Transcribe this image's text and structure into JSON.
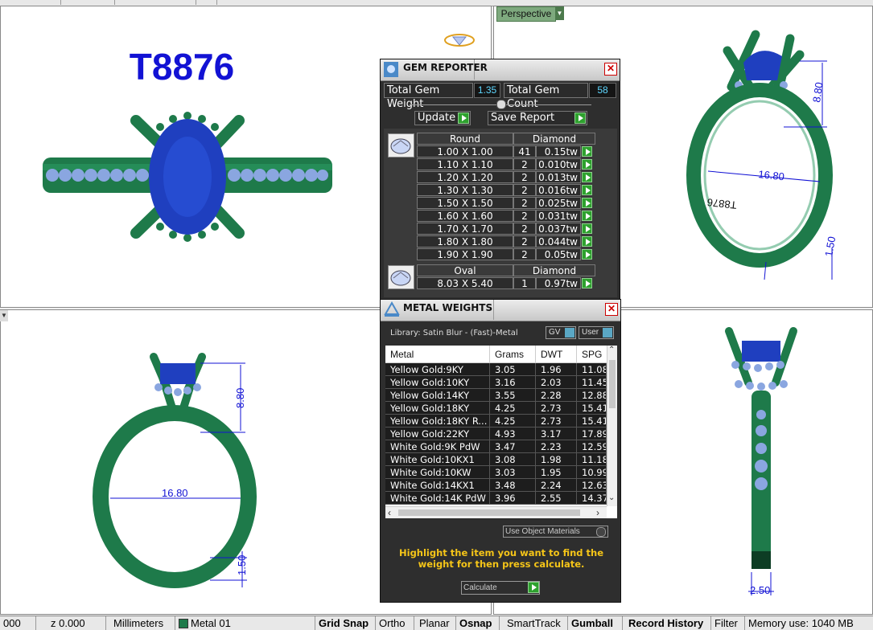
{
  "viewports": {
    "top_left": {
      "title_text": "T8876"
    },
    "top_right": {
      "view_label": "Perspective",
      "dims": {
        "height": "8.80",
        "width": "16.80",
        "band": "1.50",
        "engraving": "T8876"
      }
    },
    "bottom_left": {
      "dims": {
        "height": "8.80",
        "width": "16.80",
        "band": "1.50"
      }
    },
    "bottom_right": {
      "dims": {
        "band_width": "2.50"
      }
    }
  },
  "gem_reporter": {
    "title": "GEM REPORTER",
    "total_weight_label": "Total Gem Weight",
    "total_weight_value": "1.35",
    "total_count_label": "Total Gem Count",
    "total_count_value": "58",
    "update_label": "Update",
    "save_label": "Save Report",
    "groups": [
      {
        "shape": "Round",
        "material": "Diamond",
        "rows": [
          {
            "size": "1.00 X 1.00",
            "count": "41",
            "weight": "0.15tw"
          },
          {
            "size": "1.10 X 1.10",
            "count": "2",
            "weight": "0.010tw"
          },
          {
            "size": "1.20 X 1.20",
            "count": "2",
            "weight": "0.013tw"
          },
          {
            "size": "1.30 X 1.30",
            "count": "2",
            "weight": "0.016tw"
          },
          {
            "size": "1.50 X 1.50",
            "count": "2",
            "weight": "0.025tw"
          },
          {
            "size": "1.60 X 1.60",
            "count": "2",
            "weight": "0.031tw"
          },
          {
            "size": "1.70 X 1.70",
            "count": "2",
            "weight": "0.037tw"
          },
          {
            "size": "1.80 X 1.80",
            "count": "2",
            "weight": "0.044tw"
          },
          {
            "size": "1.90 X 1.90",
            "count": "2",
            "weight": "0.05tw"
          }
        ]
      },
      {
        "shape": "Oval",
        "material": "Diamond",
        "rows": [
          {
            "size": "8.03 X 5.40",
            "count": "1",
            "weight": "0.97tw"
          }
        ]
      }
    ]
  },
  "metal_weights": {
    "title": "METAL WEIGHTS",
    "library": "Library: Satin Blur - (Fast)-Metal",
    "gv_label": "GV",
    "user_label": "User",
    "columns": [
      "Metal",
      "Grams",
      "DWT",
      "SPG"
    ],
    "rows": [
      [
        "Yellow Gold:9KY",
        "3.05",
        "1.96",
        "11.08"
      ],
      [
        "Yellow Gold:10KY",
        "3.16",
        "2.03",
        "11.45"
      ],
      [
        "Yellow Gold:14KY",
        "3.55",
        "2.28",
        "12.88"
      ],
      [
        "Yellow Gold:18KY",
        "4.25",
        "2.73",
        "15.41"
      ],
      [
        "Yellow Gold:18KY R...",
        "4.25",
        "2.73",
        "15.41"
      ],
      [
        "Yellow Gold:22KY",
        "4.93",
        "3.17",
        "17.89"
      ],
      [
        "White Gold:9K PdW",
        "3.47",
        "2.23",
        "12.59"
      ],
      [
        "White Gold:10KX1",
        "3.08",
        "1.98",
        "11.18"
      ],
      [
        "White Gold:10KW",
        "3.03",
        "1.95",
        "10.99"
      ],
      [
        "White Gold:14KX1",
        "3.48",
        "2.24",
        "12.63"
      ],
      [
        "White Gold:14K PdW",
        "3.96",
        "2.55",
        "14.37"
      ]
    ],
    "use_object_label": "Use Object Materials",
    "hint": "Highlight the item you want to find the weight for then press calculate.",
    "calculate_label": "Calculate"
  },
  "status_bar": {
    "coord_tail": "000",
    "z": "z 0.000",
    "units": "Millimeters",
    "layer": "Metal 01",
    "grid_snap": "Grid Snap",
    "ortho": "Ortho",
    "planar": "Planar",
    "osnap": "Osnap",
    "smarttrack": "SmartTrack",
    "gumball": "Gumball",
    "record_history": "Record History",
    "filter": "Filter",
    "memory": "Memory use: 1040 MB"
  },
  "colors": {
    "metal": "#1e7a4a",
    "gem": "#1f3fbf",
    "dim": "#1212d4",
    "accent_green": "#2ea12e"
  }
}
